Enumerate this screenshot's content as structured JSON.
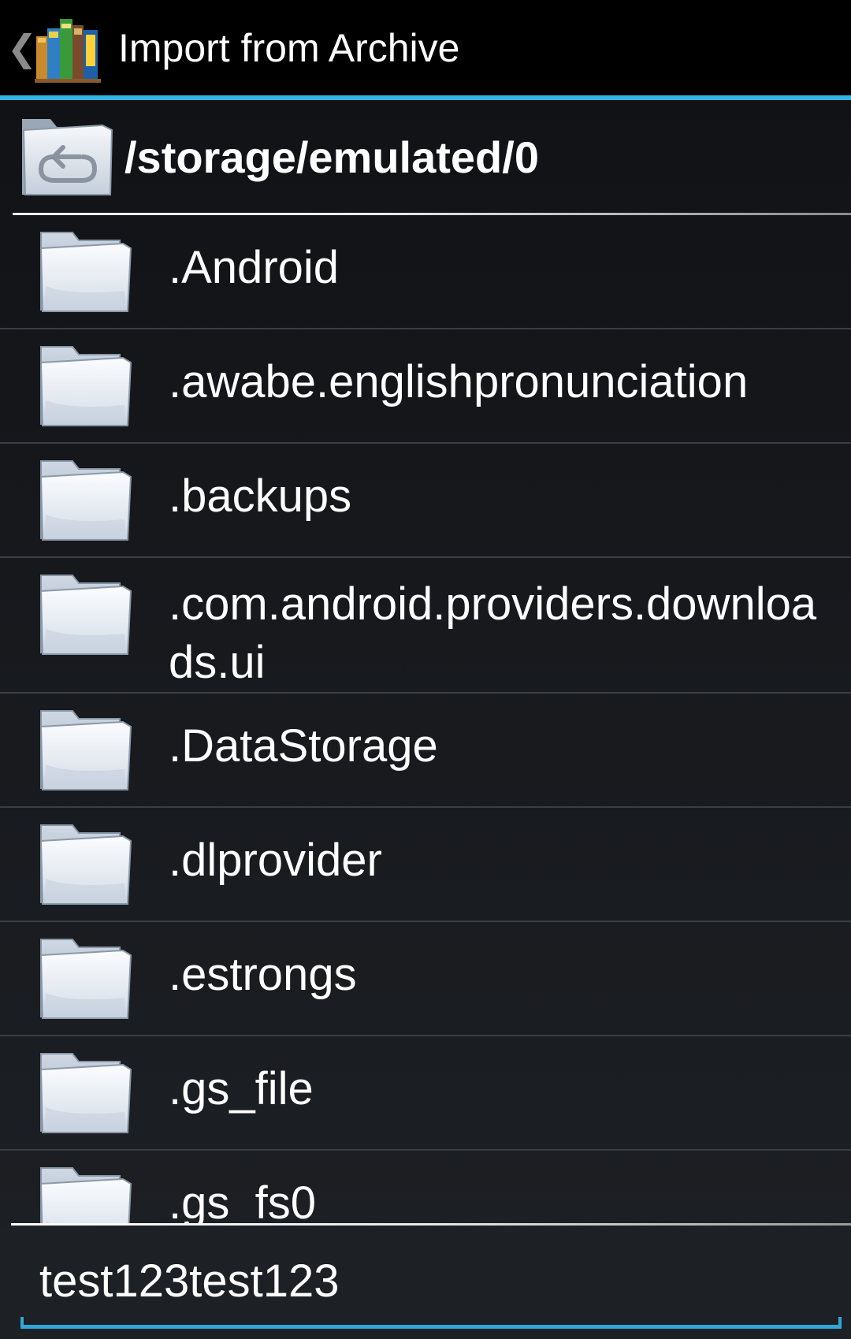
{
  "action_bar": {
    "up_glyph": "❮",
    "app_icon": "bookshelf-icon",
    "title": "Import from Archive",
    "accent_color": "#33b5e5"
  },
  "path": {
    "icon": "parent-folder-icon",
    "current": "/storage/emulated/0"
  },
  "folders": [
    {
      "name": ".Android",
      "icon": "folder-icon"
    },
    {
      "name": ".awabe.englishpronunciation",
      "icon": "folder-icon"
    },
    {
      "name": ".backups",
      "icon": "folder-icon"
    },
    {
      "name": ".com.android.providers.downloads.ui",
      "icon": "folder-icon"
    },
    {
      "name": ".DataStorage",
      "icon": "folder-icon"
    },
    {
      "name": ".dlprovider",
      "icon": "folder-icon"
    },
    {
      "name": ".estrongs",
      "icon": "folder-icon"
    },
    {
      "name": ".gs_file",
      "icon": "folder-icon"
    },
    {
      "name": ".gs_fs0",
      "icon": "folder-icon"
    }
  ],
  "filename_input": {
    "value": "test123test123"
  }
}
